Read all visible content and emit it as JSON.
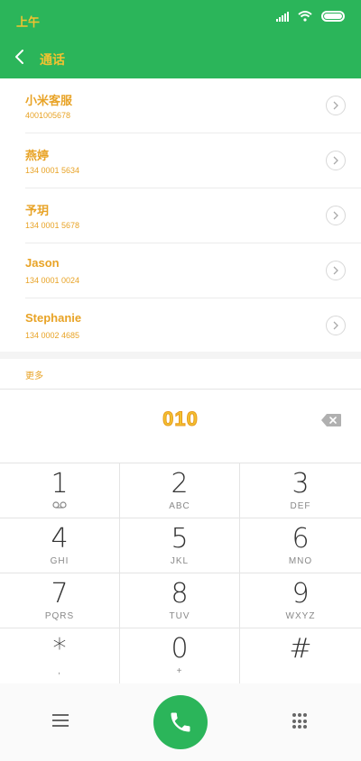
{
  "status_bar": {
    "time": "上午",
    "icons": [
      "signal-icon",
      "wifi-icon",
      "battery-icon"
    ]
  },
  "header": {
    "title": "通话",
    "back_icon": "back-arrow-icon"
  },
  "contacts": [
    {
      "name": "小米客服",
      "number": "4001005678"
    },
    {
      "name": "燕婷",
      "number": "134 0001 5634"
    },
    {
      "name": "予玥",
      "number": "134 0001 5678"
    },
    {
      "name": "Jason",
      "number": "134 0001 0024"
    },
    {
      "name": "Stephanie",
      "number": "134 0002 4685"
    }
  ],
  "section_label": "更多",
  "dialed_number": "010",
  "keypad": [
    {
      "digit": "1",
      "letters": "voicemail"
    },
    {
      "digit": "2",
      "letters": "ABC"
    },
    {
      "digit": "3",
      "letters": "DEF"
    },
    {
      "digit": "4",
      "letters": "GHI"
    },
    {
      "digit": "5",
      "letters": "JKL"
    },
    {
      "digit": "6",
      "letters": "MNO"
    },
    {
      "digit": "7",
      "letters": "PQRS"
    },
    {
      "digit": "8",
      "letters": "TUV"
    },
    {
      "digit": "9",
      "letters": "WXYZ"
    },
    {
      "digit": "*",
      "letters": ","
    },
    {
      "digit": "0",
      "letters": "+"
    },
    {
      "digit": "#",
      "letters": ""
    }
  ],
  "colors": {
    "accent_green": "#2bb55a",
    "text_orange": "#e8a326",
    "text_yellow": "#f2c230"
  }
}
